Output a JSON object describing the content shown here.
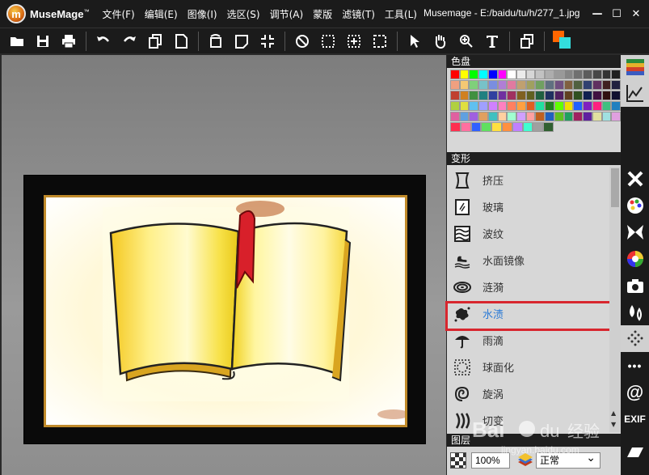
{
  "app": {
    "name": "MuseMage",
    "trademark": "™",
    "window_title": "Musemage - E:/baidu/tu/h/277_1.jpg"
  },
  "menu": [
    "文件(F)",
    "编辑(E)",
    "图像(I)",
    "选区(S)",
    "调节(A)",
    "蒙版",
    "滤镜(T)",
    "工具(L)"
  ],
  "window_buttons": {
    "minimize": "—",
    "maximize": "☐",
    "close": "✕"
  },
  "toolbar": {
    "file": [
      "open",
      "save",
      "print"
    ],
    "edit": [
      "undo",
      "redo",
      "copy",
      "new"
    ],
    "transform": [
      "rotate",
      "crop",
      "fit"
    ],
    "select": [
      "deselect",
      "select-rect",
      "select-move",
      "select-all"
    ],
    "tools": [
      "pointer",
      "hand",
      "zoom",
      "text"
    ],
    "layers": [
      "layers"
    ],
    "colors": {
      "foreground": "#ff6600",
      "background": "#33dddd"
    }
  },
  "palette": {
    "title": "色盘",
    "rows": [
      [
        "#ff0000",
        "#ffff00",
        "#00ff00",
        "#00ffff",
        "#0000ff",
        "#ff00ff",
        "#ffffff",
        "#ebebeb",
        "#d6d6d6",
        "#c2c2c2",
        "#adadad",
        "#999999",
        "#858585",
        "#707070",
        "#5c5c5c",
        "#474747",
        "#333333",
        "#1f1f1f"
      ],
      [
        "#f0a080",
        "#f4c873",
        "#7fd07a",
        "#78c2c8",
        "#7a8ee0",
        "#b07ed6",
        "#e07aa0",
        "#c0a070",
        "#a0a060",
        "#70a060",
        "#607080",
        "#705080",
        "#806040",
        "#506040",
        "#304070",
        "#603060",
        "#402020",
        "#202040"
      ],
      [
        "#c04030",
        "#d08020",
        "#409040",
        "#208080",
        "#3040a0",
        "#7030a0",
        "#a03060",
        "#806020",
        "#606020",
        "#206040",
        "#203060",
        "#502060",
        "#604020",
        "#305020",
        "#102050",
        "#401040",
        "#301010",
        "#101030"
      ],
      [
        "#b0d040",
        "#e0e040",
        "#60c0f0",
        "#a0a0ff",
        "#d080ff",
        "#ff80c0",
        "#ff8060",
        "#ffa040",
        "#e06020",
        "#20e0a0",
        "#208020",
        "#60ff00",
        "#f0e000",
        "#2060ff",
        "#8020c0",
        "#ff2080",
        "#40c080",
        "#2080c0"
      ],
      [
        "#e060a0",
        "#60a0e0",
        "#a060e0",
        "#e0a060",
        "#40c0c0",
        "#ffd0a0",
        "#a0ffd0",
        "#d0a0ff",
        "#ffa0a0",
        "#c06020",
        "#2060c0",
        "#60c020",
        "#20a060",
        "#a02060",
        "#6020a0",
        "#e0e0a0",
        "#a0e0e0",
        "#e0a0e0"
      ],
      [
        "#ff3050",
        "#ff70a0",
        "#3060ff",
        "#60e060",
        "#ffe040",
        "#ff9040",
        "#c080ff",
        "#40ffd0",
        "#a0a0a0",
        "#306030"
      ]
    ]
  },
  "transform_panel": {
    "title": "变形",
    "items": [
      {
        "label": "挤压",
        "icon": "squeeze-icon",
        "selected": false
      },
      {
        "label": "玻璃",
        "icon": "glass-icon",
        "selected": false
      },
      {
        "label": "波纹",
        "icon": "ripple-icon",
        "selected": false
      },
      {
        "label": "水面镜像",
        "icon": "water-mirror-icon",
        "selected": false
      },
      {
        "label": "涟漪",
        "icon": "ripple-rings-icon",
        "selected": false
      },
      {
        "label": "水渍",
        "icon": "water-stain-icon",
        "selected": true
      },
      {
        "label": "雨滴",
        "icon": "raindrop-umbrella-icon",
        "selected": false
      },
      {
        "label": "球面化",
        "icon": "spherize-icon",
        "selected": false
      },
      {
        "label": "旋涡",
        "icon": "swirl-icon",
        "selected": false
      },
      {
        "label": "切变",
        "icon": "shear-icon",
        "selected": false
      }
    ]
  },
  "layers_panel": {
    "title": "图层",
    "opacity": "100%",
    "blend_mode": "正常"
  },
  "right_strip": {
    "buttons": [
      "palette-icon",
      "curve-icon",
      "tools-icon",
      "color-palette-icon",
      "butterfly-icon",
      "color-wheel-icon",
      "camera-icon",
      "drops-icon",
      "dots-pattern-icon",
      "more-icon",
      "at-icon",
      "exif-icon"
    ],
    "exif_label": "EXIF",
    "more_label": "•••",
    "at_label": "@"
  }
}
